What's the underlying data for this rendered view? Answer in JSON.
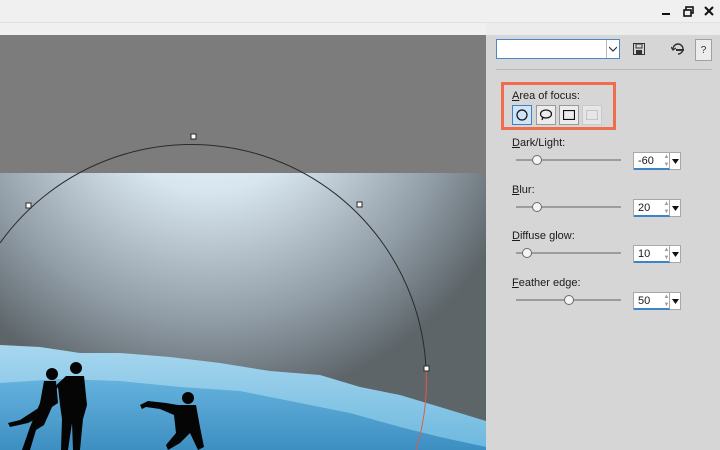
{
  "window": {
    "minimize_icon": "minimize-icon",
    "restore_icon": "restore-icon",
    "close_icon": "close-icon"
  },
  "toolbar": {
    "preset_value": "",
    "save_icon": "save-icon",
    "reset_icon": "reset-icon",
    "help_label": "?"
  },
  "focus": {
    "label_accel": "A",
    "label_rest": "rea of focus:",
    "shapes": [
      {
        "name": "circle",
        "active": true
      },
      {
        "name": "freehand",
        "active": false
      },
      {
        "name": "rectangle",
        "active": false
      },
      {
        "name": "disabled",
        "active": false
      }
    ]
  },
  "controls": [
    {
      "label_pre": "",
      "label_accel": "D",
      "label_post": "ark/Light:",
      "value": "-60",
      "level": 0.2
    },
    {
      "label_pre": "",
      "label_accel": "B",
      "label_post": "lur:",
      "value": "20",
      "level": 0.2
    },
    {
      "label_pre": "",
      "label_accel": "D",
      "label_post": "iffuse glow:",
      "value": "10",
      "level": 0.1
    },
    {
      "label_pre": "",
      "label_accel": "F",
      "label_post": "eather edge:",
      "value": "50",
      "level": 0.5
    }
  ],
  "colors": {
    "highlight_box": "#ef6c4f",
    "accent": "#3b84c8"
  }
}
